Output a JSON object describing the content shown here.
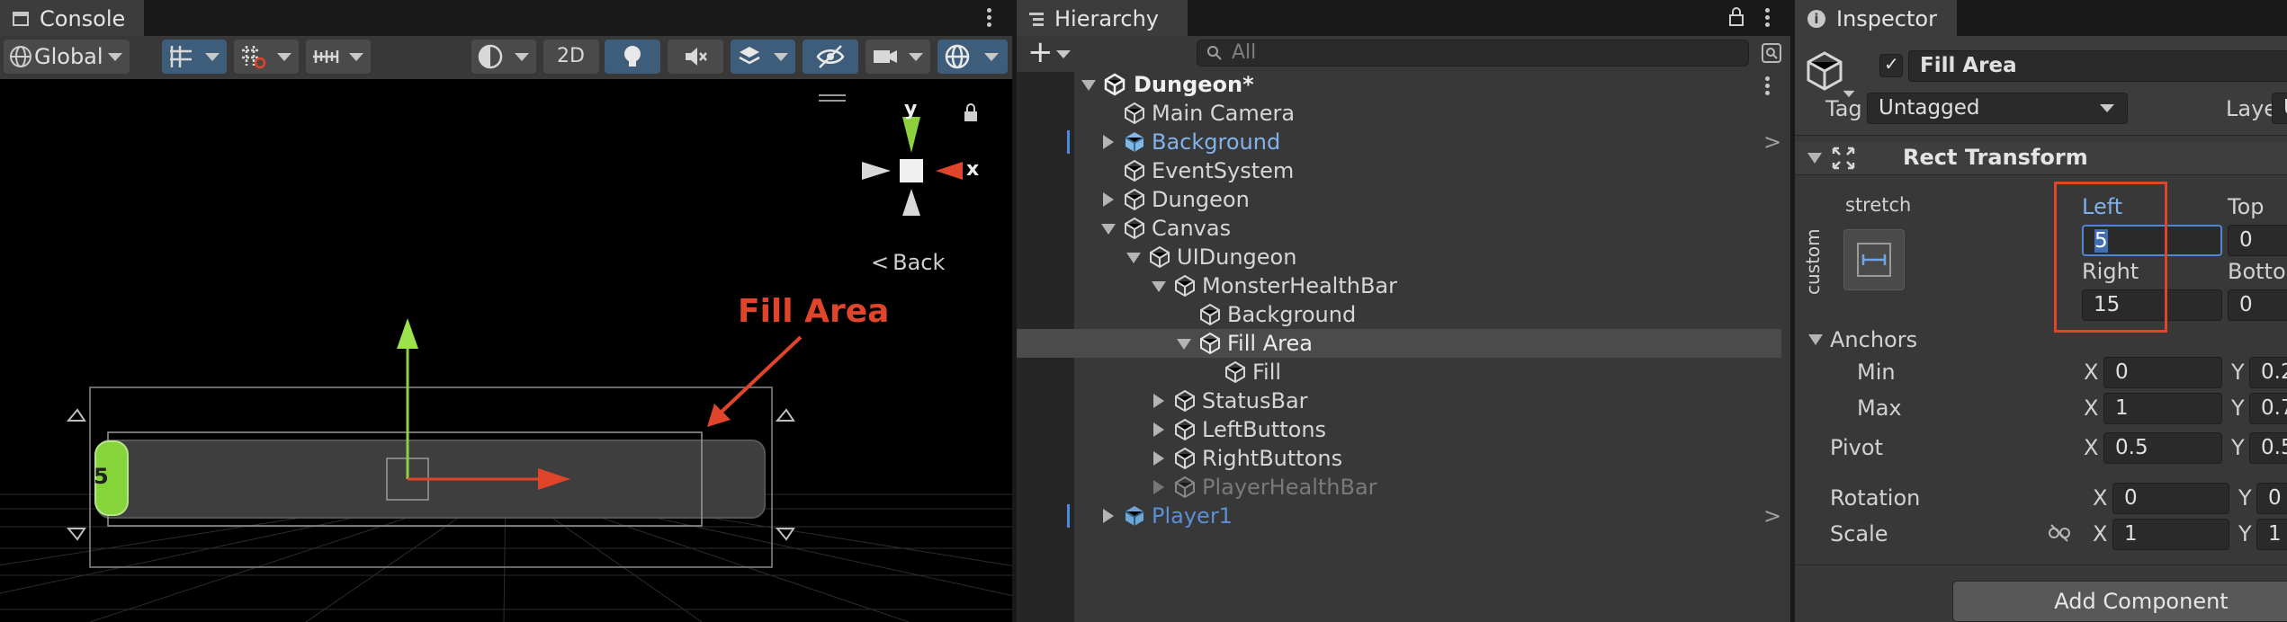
{
  "console": {
    "tab_label": "Console",
    "global_label": "Global",
    "mode_2d_label": "2D"
  },
  "scene": {
    "annotation": "Fill Area",
    "annotation_color": "#e0452c",
    "gizmo_y": "y",
    "gizmo_x": "x",
    "back_label": "Back",
    "handle_value": "5"
  },
  "hierarchy": {
    "tab_label": "Hierarchy",
    "search_placeholder": "All",
    "items": [
      {
        "label": "Dungeon*"
      },
      {
        "label": "Main Camera"
      },
      {
        "label": "Background"
      },
      {
        "label": "EventSystem"
      },
      {
        "label": "Dungeon"
      },
      {
        "label": "Canvas"
      },
      {
        "label": "UIDungeon"
      },
      {
        "label": "MonsterHealthBar"
      },
      {
        "label": "Background"
      },
      {
        "label": "Fill Area"
      },
      {
        "label": "Fill"
      },
      {
        "label": "StatusBar"
      },
      {
        "label": "LeftButtons"
      },
      {
        "label": "RightButtons"
      },
      {
        "label": "PlayerHealthBar"
      },
      {
        "label": "Player1"
      }
    ]
  },
  "inspector": {
    "tab_label": "Inspector",
    "object_name": "Fill Area",
    "tag_label": "Tag",
    "tag_value": "Untagged",
    "layer_label": "Layer",
    "layer_value": "U",
    "component_title": "Rect Transform",
    "stretch_label": "stretch",
    "custom_label": "custom",
    "left_label": "Left",
    "left_value": "5",
    "top_label": "Top",
    "top_value": "0",
    "right_label": "Right",
    "right_value": "15",
    "bottom_label": "Botto",
    "bottom_value": "0",
    "anchors_label": "Anchors",
    "min_label": "Min",
    "min_x": "0",
    "min_y": "0.2",
    "max_label": "Max",
    "max_x": "1",
    "max_y": "0.7",
    "pivot_label": "Pivot",
    "pivot_x": "0.5",
    "pivot_y": "0.5",
    "rotation_label": "Rotation",
    "rotation_x": "0",
    "rotation_y": "0",
    "scale_label": "Scale",
    "scale_x": "1",
    "scale_y": "1",
    "x_label": "X",
    "y_label": "Y",
    "add_component_label": "Add Component",
    "highlight_color": "#e0452c"
  }
}
